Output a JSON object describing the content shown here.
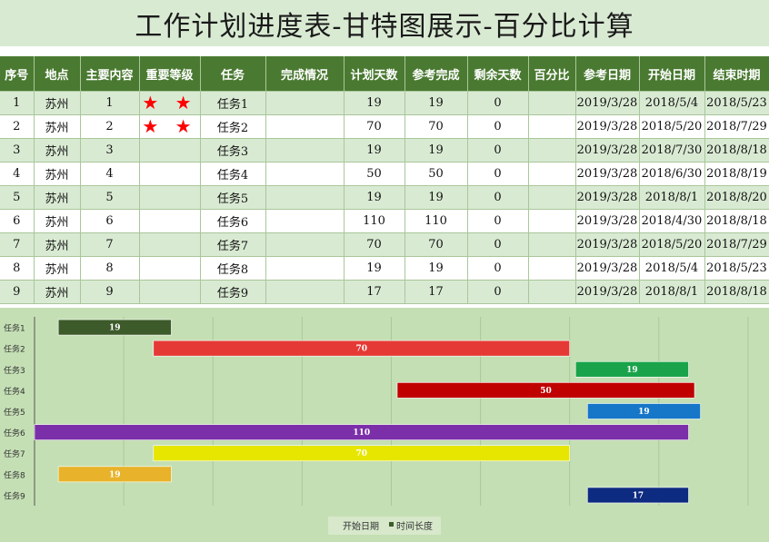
{
  "title": "工作计划进度表-甘特图展示-百分比计算",
  "table": {
    "headers": [
      "序号",
      "地点",
      "主要内容",
      "重要等级",
      "任务",
      "完成情况",
      "计划天数",
      "参考完成",
      "剩余天数",
      "百分比",
      "参考日期",
      "开始日期",
      "结束时期"
    ],
    "rows": [
      {
        "seq": "1",
        "location": "苏州",
        "content": "1",
        "stars": "★ ★",
        "task": "任务1",
        "status": "",
        "plan": "19",
        "ref_done": "19",
        "remaining": "0",
        "percent": "",
        "ref_date": "2019/3/28",
        "start": "2018/5/4",
        "end": "2018/5/23"
      },
      {
        "seq": "2",
        "location": "苏州",
        "content": "2",
        "stars": "★ ★",
        "task": "任务2",
        "status": "",
        "plan": "70",
        "ref_done": "70",
        "remaining": "0",
        "percent": "",
        "ref_date": "2019/3/28",
        "start": "2018/5/20",
        "end": "2018/7/29"
      },
      {
        "seq": "3",
        "location": "苏州",
        "content": "3",
        "stars": "",
        "task": "任务3",
        "status": "",
        "plan": "19",
        "ref_done": "19",
        "remaining": "0",
        "percent": "",
        "ref_date": "2019/3/28",
        "start": "2018/7/30",
        "end": "2018/8/18"
      },
      {
        "seq": "4",
        "location": "苏州",
        "content": "4",
        "stars": "",
        "task": "任务4",
        "status": "",
        "plan": "50",
        "ref_done": "50",
        "remaining": "0",
        "percent": "",
        "ref_date": "2019/3/28",
        "start": "2018/6/30",
        "end": "2018/8/19"
      },
      {
        "seq": "5",
        "location": "苏州",
        "content": "5",
        "stars": "",
        "task": "任务5",
        "status": "",
        "plan": "19",
        "ref_done": "19",
        "remaining": "0",
        "percent": "",
        "ref_date": "2019/3/28",
        "start": "2018/8/1",
        "end": "2018/8/20"
      },
      {
        "seq": "6",
        "location": "苏州",
        "content": "6",
        "stars": "",
        "task": "任务6",
        "status": "",
        "plan": "110",
        "ref_done": "110",
        "remaining": "0",
        "percent": "",
        "ref_date": "2019/3/28",
        "start": "2018/4/30",
        "end": "2018/8/18"
      },
      {
        "seq": "7",
        "location": "苏州",
        "content": "7",
        "stars": "",
        "task": "任务7",
        "status": "",
        "plan": "70",
        "ref_done": "70",
        "remaining": "0",
        "percent": "",
        "ref_date": "2019/3/28",
        "start": "2018/5/20",
        "end": "2018/7/29"
      },
      {
        "seq": "8",
        "location": "苏州",
        "content": "8",
        "stars": "",
        "task": "任务8",
        "status": "",
        "plan": "19",
        "ref_done": "19",
        "remaining": "0",
        "percent": "",
        "ref_date": "2019/3/28",
        "start": "2018/5/4",
        "end": "2018/5/23"
      },
      {
        "seq": "9",
        "location": "苏州",
        "content": "9",
        "stars": "",
        "task": "任务9",
        "status": "",
        "plan": "17",
        "ref_done": "17",
        "remaining": "0",
        "percent": "",
        "ref_date": "2019/3/28",
        "start": "2018/8/1",
        "end": "2018/8/18"
      }
    ]
  },
  "chart_data": {
    "type": "bar",
    "orientation": "horizontal-stacked",
    "categories": [
      "任务1",
      "任务2",
      "任务3",
      "任务4",
      "任务5",
      "任务6",
      "任务7",
      "任务8",
      "任务9"
    ],
    "series": [
      {
        "name": "开始日期",
        "values": [
          "2018/5/4",
          "2018/5/20",
          "2018/7/30",
          "2018/6/30",
          "2018/8/1",
          "2018/4/30",
          "2018/5/20",
          "2018/5/4",
          "2018/8/1"
        ],
        "visible": false
      },
      {
        "name": "时间长度",
        "values": [
          19,
          70,
          19,
          50,
          19,
          110,
          70,
          19,
          17
        ]
      }
    ],
    "bar_colors": [
      "#3d5a2a",
      "#e53935",
      "#1aa34a",
      "#c00000",
      "#1676c8",
      "#7b2fa8",
      "#e6e600",
      "#e8b32a",
      "#0d2b80"
    ],
    "label_colors": [
      "#ffffff",
      "#ffffff",
      "#ffffff",
      "#ffffff",
      "#ffffff",
      "#ffffff",
      "#ffffff",
      "#ffffff",
      "#ffffff"
    ],
    "xlim": [
      "2018/4/30",
      "2018/8/30"
    ],
    "grid": true,
    "legend": "bottom"
  }
}
